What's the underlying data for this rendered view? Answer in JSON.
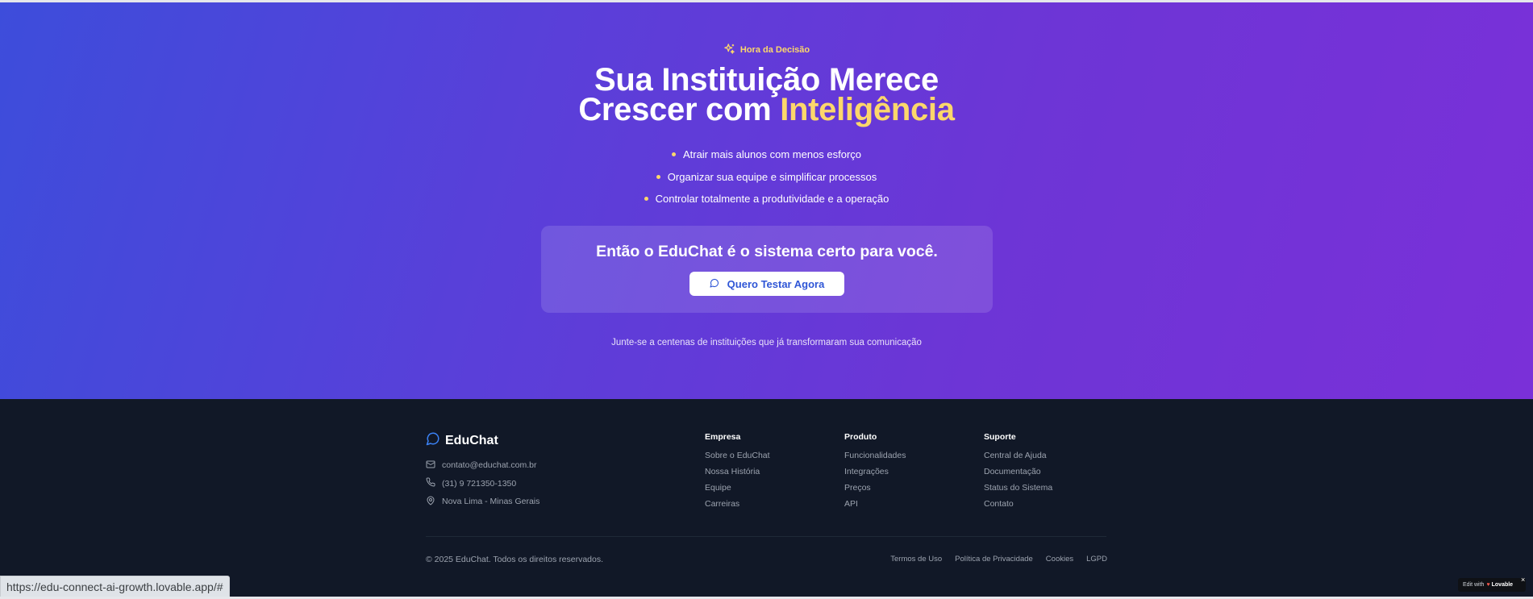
{
  "hero": {
    "eyebrow": "Hora da Decisão",
    "title_line1": "Sua Instituição Merece",
    "title_line2_prefix": "Crescer com ",
    "title_line2_accent": "Inteligência",
    "bullets": [
      "Atrair mais alunos com menos esforço",
      "Organizar sua equipe e simplificar processos",
      "Controlar totalmente a produtividade e a operação"
    ],
    "cta_headline": "Então o EduChat é o sistema certo para você.",
    "cta_button": "Quero Testar Agora",
    "social_proof": "Junte-se a centenas de instituições que já transformaram sua comunicação"
  },
  "footer": {
    "brand": "EduChat",
    "contacts": {
      "email": "contato@educhat.com.br",
      "phone": "(31) 9 721350-1350",
      "location": "Nova Lima - Minas Gerais"
    },
    "columns": [
      {
        "title": "Empresa",
        "links": [
          "Sobre o EduChat",
          "Nossa História",
          "Equipe",
          "Carreiras"
        ]
      },
      {
        "title": "Produto",
        "links": [
          "Funcionalidades",
          "Integrações",
          "Preços",
          "API"
        ]
      },
      {
        "title": "Suporte",
        "links": [
          "Central de Ajuda",
          "Documentação",
          "Status do Sistema",
          "Contato"
        ]
      }
    ],
    "copyright": "© 2025 EduChat. Todos os direitos reservados.",
    "legal": [
      "Termos de Uso",
      "Política de Privacidade",
      "Cookies",
      "LGPD"
    ]
  },
  "browser": {
    "status_url": "https://edu-connect-ai-growth.lovable.app/#"
  },
  "badge": {
    "prefix": "Edit with",
    "brand": "Lovable",
    "close": "×"
  },
  "colors": {
    "accent_yellow": "#fcd76b",
    "button_text": "#2f56d6",
    "footer_bg": "#111827",
    "icon_blue": "#3b82f6"
  }
}
